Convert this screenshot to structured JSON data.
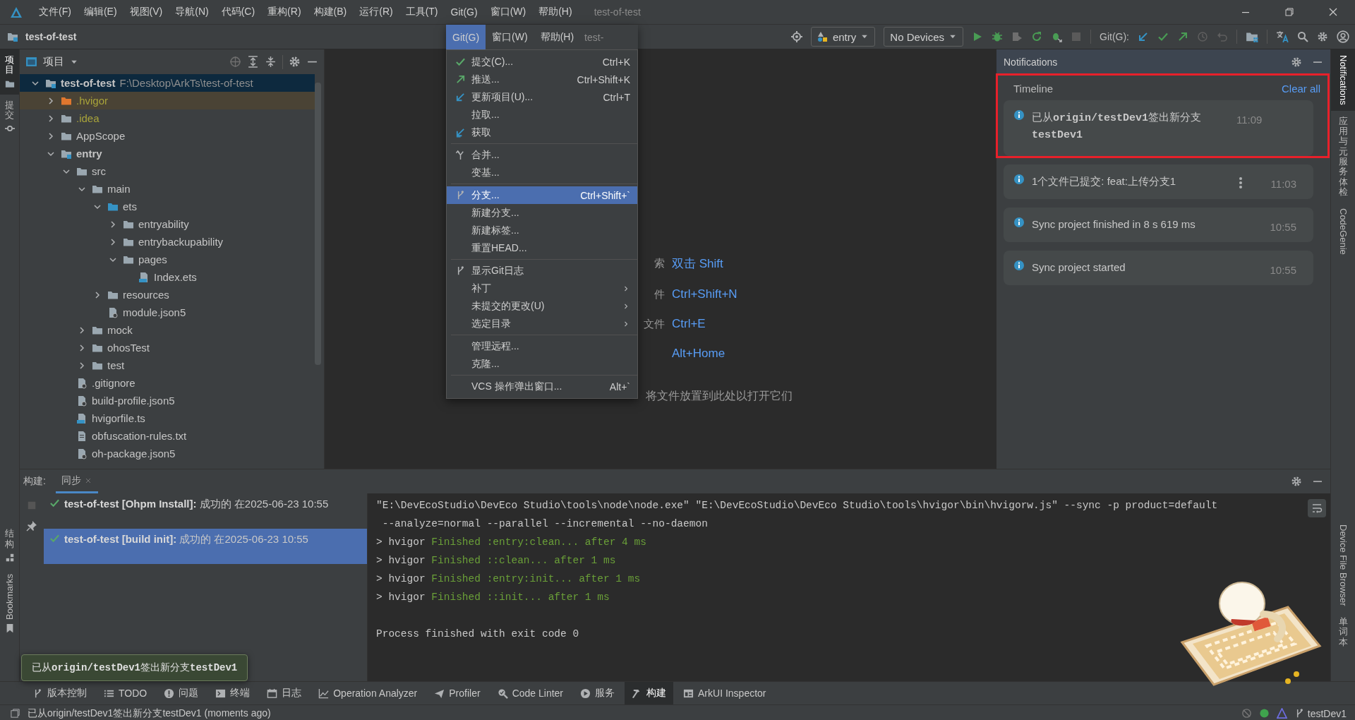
{
  "title_bar": {
    "menus": [
      "文件(F)",
      "编辑(E)",
      "视图(V)",
      "导航(N)",
      "代码(C)",
      "重构(R)",
      "构建(B)",
      "运行(R)",
      "工具(T)",
      "Git(G)",
      "窗口(W)",
      "帮助(H)"
    ],
    "title": "test-of-test"
  },
  "toolbar": {
    "project": "test-of-test",
    "run_config": "entry",
    "device": "No Devices",
    "git_label": "Git(G):"
  },
  "left_strip": {
    "top": [
      {
        "label": "项目",
        "selected": true
      },
      {
        "label": "提交",
        "selected": false
      }
    ],
    "bottom": [
      {
        "label": "结构",
        "kind": "stacked"
      },
      {
        "label": "Bookmarks",
        "kind": "rotated"
      }
    ]
  },
  "project_panel": {
    "title": "项目",
    "tree": [
      {
        "name": "test-of-test",
        "path": "F:\\Desktop\\ArkTs\\test-of-test",
        "kind": "module",
        "selected": true,
        "expanded": true,
        "children": [
          {
            "name": ".hvigor",
            "kind": "excluded",
            "selected": false,
            "expanded": false
          },
          {
            "name": ".idea",
            "kind": "ignored",
            "selected": false,
            "expanded": false
          },
          {
            "name": "AppScope",
            "kind": "folder",
            "selected": false,
            "expanded": false
          },
          {
            "name": "entry",
            "kind": "module",
            "selected": false,
            "expanded": true,
            "children": [
              {
                "name": "src",
                "kind": "folder",
                "selected": false,
                "expanded": true,
                "children": [
                  {
                    "name": "main",
                    "kind": "folder",
                    "selected": false,
                    "expanded": true,
                    "children": [
                      {
                        "name": "ets",
                        "kind": "source",
                        "selected": false,
                        "expanded": true,
                        "children": [
                          {
                            "name": "entryability",
                            "kind": "folder",
                            "selected": false,
                            "expanded": false
                          },
                          {
                            "name": "entrybackupability",
                            "kind": "folder",
                            "selected": false,
                            "expanded": false
                          },
                          {
                            "name": "pages",
                            "kind": "folder",
                            "selected": false,
                            "expanded": true,
                            "children": [
                              {
                                "name": "Index.ets",
                                "kind": "ets",
                                "selected": false
                              }
                            ]
                          }
                        ]
                      },
                      {
                        "name": "resources",
                        "kind": "folder",
                        "selected": false,
                        "expanded": false
                      },
                      {
                        "name": "module.json5",
                        "kind": "json",
                        "selected": false
                      }
                    ]
                  },
                  {
                    "name": "mock",
                    "kind": "folder",
                    "selected": false,
                    "expanded": false
                  },
                  {
                    "name": "ohosTest",
                    "kind": "folder",
                    "selected": false,
                    "expanded": false
                  },
                  {
                    "name": "test",
                    "kind": "folder",
                    "selected": false,
                    "expanded": false
                  }
                ]
              },
              {
                "name": ".gitignore",
                "kind": "gitignore",
                "selected": false
              },
              {
                "name": "build-profile.json5",
                "kind": "json",
                "selected": false
              },
              {
                "name": "hvigorfile.ts",
                "kind": "ts",
                "selected": false
              },
              {
                "name": "obfuscation-rules.txt",
                "kind": "txt",
                "selected": false
              },
              {
                "name": "oh-package.json5",
                "kind": "json",
                "selected": false
              }
            ]
          }
        ]
      }
    ]
  },
  "git_menu": {
    "menus": [
      {
        "label": "Git(G)",
        "selected": true
      },
      {
        "label": "窗口(W)",
        "selected": false
      },
      {
        "label": "帮助(H)",
        "selected": false
      }
    ],
    "title": "test-",
    "items": [
      {
        "kind": "commit",
        "label": "提交(C)...",
        "shortcut": "Ctrl+K",
        "selected": false
      },
      {
        "kind": "push",
        "label": "推送...",
        "shortcut": "Ctrl+Shift+K",
        "selected": false
      },
      {
        "kind": "update",
        "label": "更新项目(U)...",
        "shortcut": "Ctrl+T",
        "selected": false
      },
      {
        "kind": "plain",
        "label": "拉取...",
        "selected": false
      },
      {
        "kind": "fetch",
        "label": "获取",
        "selected": false
      },
      {
        "kind": "separator"
      },
      {
        "kind": "merge",
        "label": "合并...",
        "selected": false
      },
      {
        "kind": "plain",
        "label": "变基...",
        "selected": false
      },
      {
        "kind": "separator"
      },
      {
        "kind": "branch",
        "label": "分支...",
        "shortcut": "Ctrl+Shift+`",
        "selected": true
      },
      {
        "kind": "plain",
        "label": "新建分支...",
        "selected": false
      },
      {
        "kind": "plain",
        "label": "新建标签...",
        "selected": false
      },
      {
        "kind": "plain",
        "label": "重置HEAD...",
        "selected": false
      },
      {
        "kind": "separator"
      },
      {
        "kind": "branch",
        "label": "显示Git日志",
        "selected": false
      },
      {
        "kind": "submenu",
        "label": "补丁",
        "selected": false
      },
      {
        "kind": "submenu",
        "label": "未提交的更改(U)",
        "selected": false
      },
      {
        "kind": "submenu",
        "label": "选定目录",
        "selected": false
      },
      {
        "kind": "separator"
      },
      {
        "kind": "plain",
        "label": "管理远程...",
        "selected": false
      },
      {
        "kind": "plain",
        "label": "克隆...",
        "selected": false
      },
      {
        "kind": "separator"
      },
      {
        "kind": "plain",
        "label": "VCS 操作弹出窗口...",
        "shortcut": "Alt+`",
        "selected": false
      }
    ]
  },
  "editor": {
    "hints": [
      {
        "action": "索",
        "keys": "双击 Shift"
      },
      {
        "action": "件",
        "keys": "Ctrl+Shift+N"
      },
      {
        "action": "文件",
        "keys": "Ctrl+E"
      },
      {
        "keys": "Alt+Home"
      }
    ],
    "drop_hint": "将文件放置到此处以打开它们"
  },
  "notifications": {
    "title": "Notifications",
    "section": "Timeline",
    "clear": "Clear all",
    "items": [
      {
        "text": "已从**origin/testDev1**签出新分支**testDev1**",
        "time": "11:09",
        "hovered": false
      },
      {
        "text": "1个文件已提交: feat:上传分支1",
        "time": "11:03",
        "hovered": true
      },
      {
        "text": "Sync project finished in 8 s 619 ms",
        "time": "10:55",
        "hovered": false
      },
      {
        "text": "Sync project started",
        "time": "10:55",
        "hovered": false
      }
    ]
  },
  "right_strip": {
    "top": [
      {
        "label": "Notifications",
        "kind": "rotated",
        "selected": true
      },
      {
        "label": "应用与元服务体检",
        "kind": "stacked",
        "selected": false
      },
      {
        "label": "CodeGenie",
        "kind": "rotated",
        "selected": false
      }
    ],
    "bottom": [
      {
        "label": "Device File Browser",
        "kind": "rotated"
      },
      {
        "label": "单词本",
        "kind": "stacked"
      }
    ]
  },
  "build": {
    "label": "构建:",
    "tabs": [
      {
        "label": "同步",
        "selected": true
      }
    ],
    "runs": [
      {
        "title": "test-of-test [Ohpm Install]:",
        "result": "成功的 在2025-06-23 10:55",
        "selected": false
      },
      {
        "title": "test-of-test [build init]:",
        "result": "成功的 在2025-06-23 10:55",
        "selected": true
      }
    ],
    "console": [
      {
        "kind": "plain",
        "text": "\"E:\\DevEcoStudio\\DevEco Studio\\tools\\node\\node.exe\" \"E:\\DevEcoStudio\\DevEco Studio\\tools\\hvigor\\bin\\hvigorw.js\" --sync -p product=default"
      },
      {
        "kind": "plain",
        "text": " --analyze=normal --parallel --incremental --no-daemon"
      },
      {
        "kind": "task",
        "prompt": "> hvigor",
        "text": "Finished :entry:clean... after 4 ms"
      },
      {
        "kind": "task",
        "prompt": "> hvigor",
        "text": "Finished ::clean... after 1 ms"
      },
      {
        "kind": "task",
        "prompt": "> hvigor",
        "text": "Finished :entry:init... after 1 ms"
      },
      {
        "kind": "task",
        "prompt": "> hvigor",
        "text": "Finished ::init... after 1 ms"
      },
      {
        "kind": "blank"
      },
      {
        "kind": "plain",
        "text": "Process finished with exit code 0"
      }
    ]
  },
  "tooltip": {
    "text": "已从**origin/testDev1**签出新分支**testDev1**"
  },
  "bottom_tabs": [
    {
      "kind": "vcs",
      "label": "版本控制",
      "selected": false
    },
    {
      "kind": "todo",
      "label": "TODO",
      "selected": false
    },
    {
      "kind": "problems",
      "label": "问题",
      "selected": false
    },
    {
      "kind": "terminal",
      "label": "终端",
      "selected": false
    },
    {
      "kind": "log",
      "label": "日志",
      "selected": false
    },
    {
      "kind": "chart",
      "label": "Operation Analyzer",
      "selected": false
    },
    {
      "kind": "profiler",
      "label": "Profiler",
      "selected": false
    },
    {
      "kind": "linter",
      "label": "Code Linter",
      "selected": false
    },
    {
      "kind": "services",
      "label": "服务",
      "selected": false
    },
    {
      "kind": "build",
      "label": "构建",
      "selected": true
    },
    {
      "kind": "inspector",
      "label": "ArkUI Inspector",
      "selected": false
    }
  ],
  "status_bar": {
    "message": "已从origin/testDev1签出新分支testDev1 (moments ago)",
    "branch": "testDev1"
  }
}
